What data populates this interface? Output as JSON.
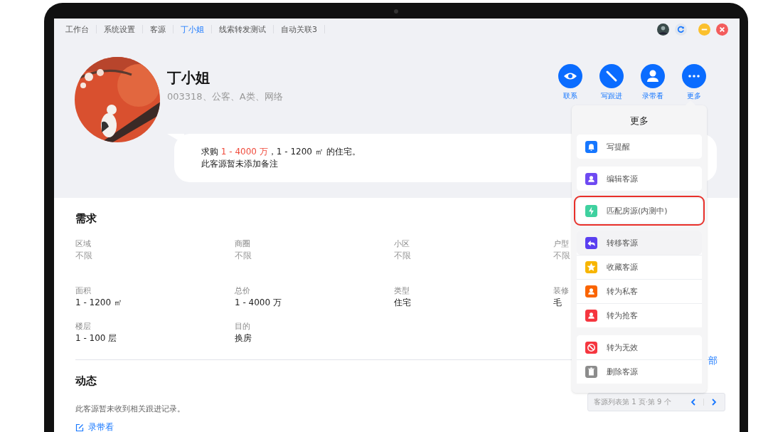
{
  "tabs": [
    {
      "label": "工作台",
      "selected": false
    },
    {
      "label": "系统设置",
      "selected": false
    },
    {
      "label": "客源",
      "selected": false
    },
    {
      "label": "丁小姐",
      "selected": true
    },
    {
      "label": "线索转发测试",
      "selected": false
    },
    {
      "label": "自动关联3",
      "selected": false
    }
  ],
  "window_controls": [
    {
      "kind": "avatar"
    },
    {
      "kind": "refresh"
    },
    {
      "kind": "minimize"
    },
    {
      "kind": "close"
    }
  ],
  "profile": {
    "name": "丁小姐",
    "tags": "003318、公客、A类、网络",
    "summary": {
      "prefix": "求购 ",
      "price": "1 - 4000 万",
      "suffix": "，1 - 1200 ㎡ 的住宅。"
    },
    "note": "此客源暂未添加备注"
  },
  "actions": [
    {
      "kind": "eye",
      "label": "联系"
    },
    {
      "kind": "pen",
      "label": "写跟进"
    },
    {
      "kind": "person",
      "label": "录带看"
    },
    {
      "kind": "more",
      "label": "更多"
    }
  ],
  "requirements": {
    "title": "需求",
    "fields": [
      {
        "label": "区域",
        "value": "不限",
        "unset": true
      },
      {
        "label": "商圈",
        "value": "不限",
        "unset": true
      },
      {
        "label": "小区",
        "value": "不限",
        "unset": true
      },
      {
        "label": "户型",
        "value": "不限",
        "unset": true
      },
      {
        "label": "面积",
        "value": "1 - 1200 ㎡",
        "unset": false
      },
      {
        "label": "总价",
        "value": "1 - 4000 万",
        "unset": false
      },
      {
        "label": "类型",
        "value": "住宅",
        "unset": false
      },
      {
        "label": "装修",
        "value": "毛",
        "unset": false
      },
      {
        "label": "楼层",
        "value": "1 - 100 层",
        "unset": false
      },
      {
        "label": "目的",
        "value": "换房",
        "unset": false
      }
    ]
  },
  "activity": {
    "title": "动态",
    "empty_text": "此客源暂未收到相关跟进记录。",
    "link": "录带看",
    "side_link": "部"
  },
  "more_menu": {
    "title": "更多",
    "groups": [
      [
        {
          "kind": "bell",
          "label": "写提醒",
          "color": "#1677ff",
          "highlighted": false,
          "hovered": false
        }
      ],
      [
        {
          "kind": "user",
          "label": "编辑客源",
          "color": "#6e4af2",
          "highlighted": false,
          "hovered": false
        }
      ],
      [
        {
          "kind": "bolt",
          "label": "匹配房源(内测中)",
          "color": "#3fd19f",
          "highlighted": true,
          "hovered": false
        }
      ],
      [
        {
          "kind": "transfer",
          "label": "转移客源",
          "color": "#5a3ff0",
          "highlighted": false,
          "hovered": true
        },
        {
          "kind": "star",
          "label": "收藏客源",
          "color": "#f7b500",
          "highlighted": false,
          "hovered": false
        },
        {
          "kind": "user",
          "label": "转为私客",
          "color": "#fa6400",
          "highlighted": false,
          "hovered": false
        },
        {
          "kind": "user",
          "label": "转为抢客",
          "color": "#f5363f",
          "highlighted": false,
          "hovered": false
        }
      ],
      [
        {
          "kind": "ban",
          "label": "转为无效",
          "color": "#f5363f",
          "highlighted": false,
          "hovered": false
        },
        {
          "kind": "trash",
          "label": "删除客源",
          "color": "#8c8c8c",
          "highlighted": false,
          "hovered": false
        }
      ]
    ]
  },
  "pager": {
    "text": "客源列表第 1 页·第 9 个"
  }
}
